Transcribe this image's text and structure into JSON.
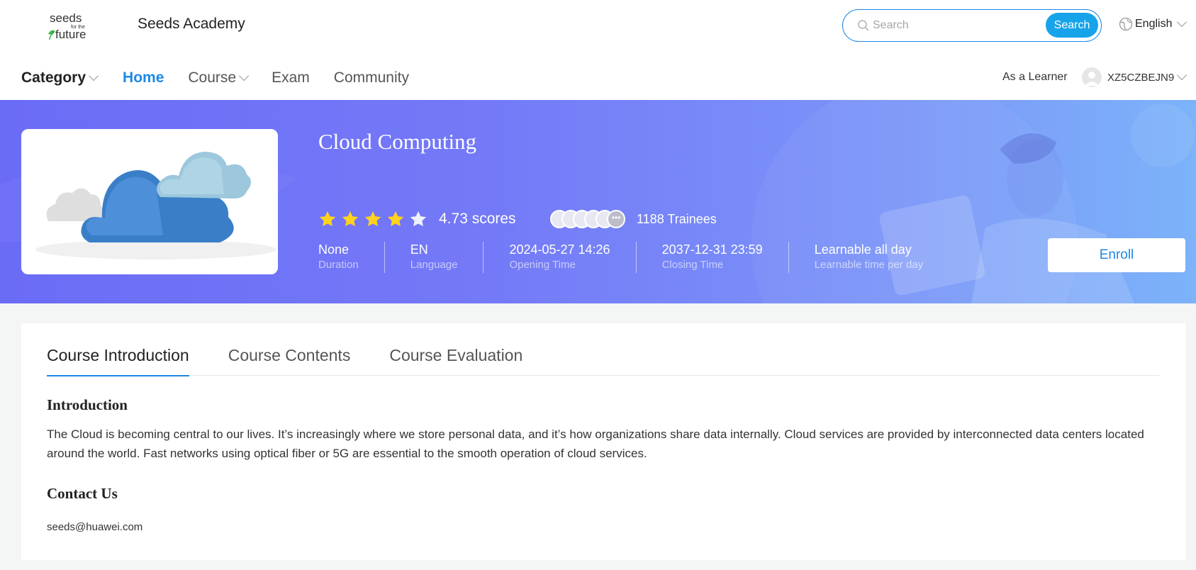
{
  "header": {
    "logo": {
      "line1": "seeds",
      "line2": "for the",
      "line3": "future"
    },
    "brand": "Seeds Academy",
    "search": {
      "placeholder": "Search",
      "value": "",
      "button_label": "Search"
    },
    "language": "English"
  },
  "nav": {
    "items": [
      {
        "label": "Category",
        "has_dropdown": true
      },
      {
        "label": "Home",
        "active": true
      },
      {
        "label": "Course",
        "has_dropdown": true
      },
      {
        "label": "Exam"
      },
      {
        "label": "Community"
      }
    ],
    "role_label": "As a Learner",
    "username": "XZ5CZBEJN9"
  },
  "course": {
    "title": "Cloud Computing",
    "rating": {
      "stars_filled": 4,
      "stars_total": 5,
      "score_text": "4.73 scores",
      "value": 4.73
    },
    "trainees": "1188 Trainees",
    "trainee_avatars_shown": 5,
    "stats": [
      {
        "value": "None",
        "label": "Duration"
      },
      {
        "value": "EN",
        "label": "Language"
      },
      {
        "value": "2024-05-27 14:26",
        "label": "Opening Time"
      },
      {
        "value": "2037-12-31 23:59",
        "label": "Closing Time"
      },
      {
        "value": "Learnable all day",
        "label": "Learnable time per day"
      }
    ],
    "enroll_label": "Enroll"
  },
  "tabs": [
    {
      "label": "Course Introduction",
      "active": true
    },
    {
      "label": "Course Contents"
    },
    {
      "label": "Course Evaluation"
    }
  ],
  "intro": {
    "heading": "Introduction",
    "text": "The Cloud is becoming central to our lives. It’s increasingly where we store personal data, and it’s how organizations share data internally.  Cloud services are provided by interconnected data centers located around the world. Fast networks using optical fiber or 5G are essential to the smooth operation of cloud services."
  },
  "contact": {
    "heading": "Contact Us",
    "email": "seeds@huawei.com"
  },
  "colors": {
    "accent": "#1e88e5",
    "search_button": "#17a3ea",
    "banner_start": "#6b6cf6",
    "banner_end": "#7cb3f9",
    "star": "#ffd21f"
  }
}
